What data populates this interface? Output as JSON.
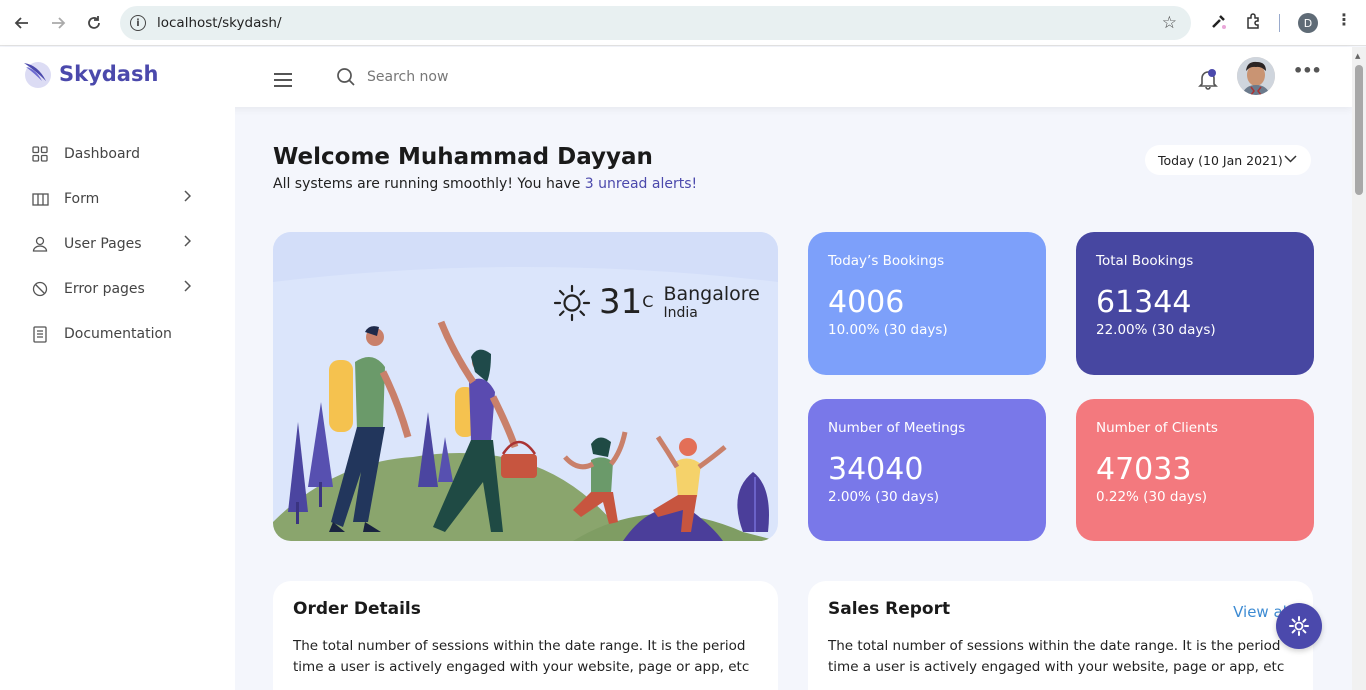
{
  "browser": {
    "url": "localhost/skydash/",
    "profile_initial": "D"
  },
  "header": {
    "brand": "Skydash",
    "search_placeholder": "Search now"
  },
  "sidebar": {
    "items": [
      {
        "label": "Dashboard",
        "icon": "grid-icon"
      },
      {
        "label": "Form",
        "icon": "columns-icon",
        "has_arrow": true
      },
      {
        "label": "User Pages",
        "icon": "user-icon",
        "has_arrow": true
      },
      {
        "label": "Error pages",
        "icon": "ban-icon",
        "has_arrow": true
      },
      {
        "label": "Documentation",
        "icon": "document-icon"
      }
    ]
  },
  "welcome": {
    "title": "Welcome Muhammad Dayyan",
    "subtitle_prefix": "All systems are running smoothly! You have ",
    "alerts_link": "3 unread alerts!",
    "date_filter": "Today (10 Jan 2021)"
  },
  "weather": {
    "temperature": "31",
    "unit": "C",
    "city": "Bangalore",
    "country": "India"
  },
  "stats": [
    {
      "title": "Today’s Bookings",
      "value": "4006",
      "change": "10.00% (30 days)",
      "color": "#7da0fa"
    },
    {
      "title": "Total Bookings",
      "value": "61344",
      "change": "22.00% (30 days)",
      "color": "#4747a1"
    },
    {
      "title": "Number of Meetings",
      "value": "34040",
      "change": "2.00% (30 days)",
      "color": "#7978e9"
    },
    {
      "title": "Number of Clients",
      "value": "47033",
      "change": "0.22% (30 days)",
      "color": "#f3797e"
    }
  ],
  "cards": {
    "order": {
      "title": "Order Details",
      "description": "The total number of sessions within the date range. It is the period time a user is actively engaged with your website, page or app, etc"
    },
    "sales": {
      "title": "Sales Report",
      "view_all": "View all",
      "description": "The total number of sessions within the date range. It is the period time a user is actively engaged with your website, page or app, etc"
    }
  },
  "colors": {
    "brand": "#4b49ac",
    "link": "#3d8bd3"
  }
}
